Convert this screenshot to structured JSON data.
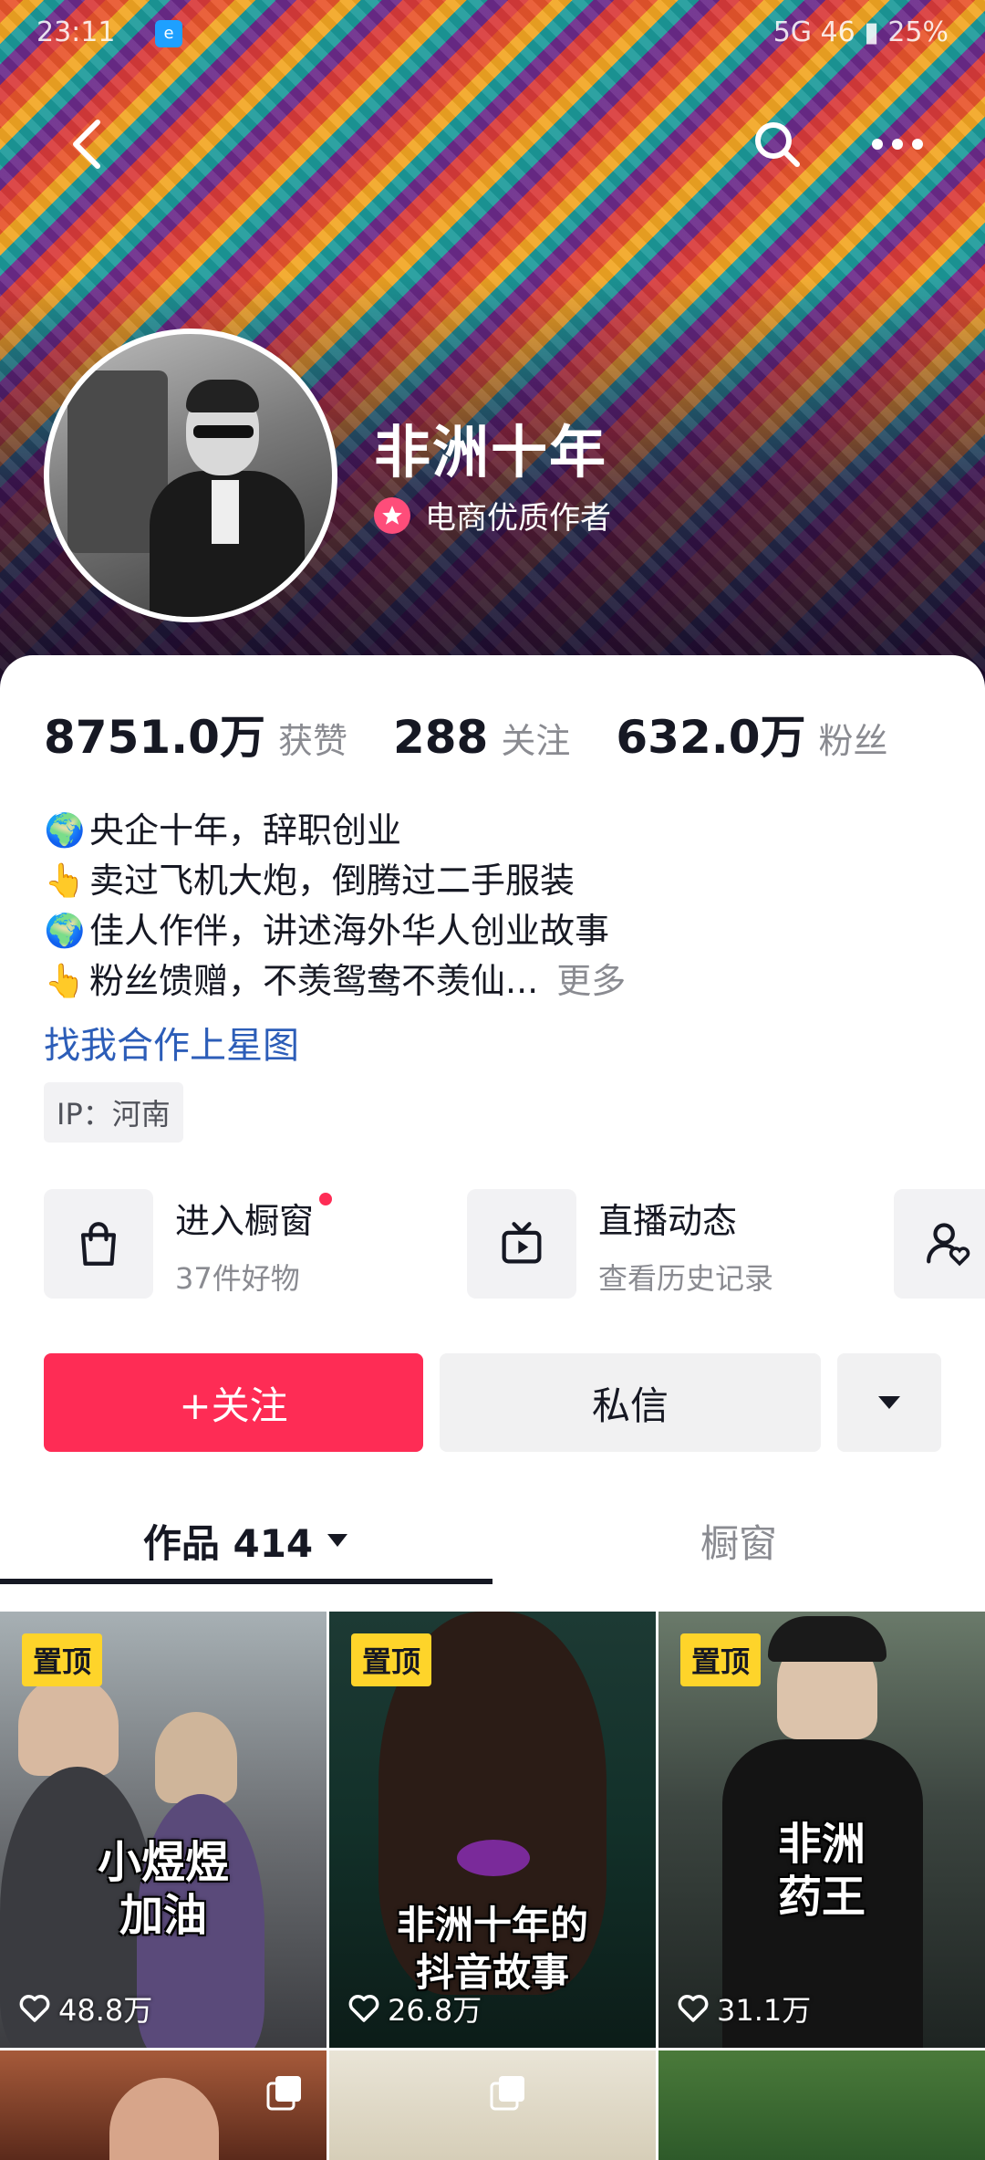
{
  "status_bar": {
    "time": "23:11",
    "app_icon_label": "e",
    "right_text": "5G  46  ▮  25%"
  },
  "header": {
    "icons": {
      "back": "chevron-left-icon",
      "search": "search-icon",
      "more": "more-dots-icon"
    }
  },
  "profile": {
    "name": "非洲十年",
    "badge_label": "电商优质作者",
    "badge_color": "#fe4d7a"
  },
  "stats": [
    {
      "value": "8751.0万",
      "label": "获赞"
    },
    {
      "value": "288",
      "label": "关注"
    },
    {
      "value": "632.0万",
      "label": "粉丝"
    }
  ],
  "bio": {
    "lines": [
      {
        "emoji": "🌍",
        "text": "央企十年，辞职创业"
      },
      {
        "emoji": "👆",
        "text": "卖过飞机大炮，倒腾过二手服装"
      },
      {
        "emoji": "🌍",
        "text": "佳人作伴，讲述海外华人创业故事"
      },
      {
        "emoji": "👆",
        "text": "粉丝馈赠，不羡鸳鸯不羡仙..."
      }
    ],
    "more_label": "更多",
    "star_link": "找我合作上星图",
    "ip_label": "IP：河南"
  },
  "features": [
    {
      "title": "进入橱窗",
      "subtitle": "37件好物",
      "icon": "shopping-bag-icon",
      "has_dot": true
    },
    {
      "title": "直播动态",
      "subtitle": "查看历史记录",
      "icon": "live-tv-icon",
      "has_dot": false
    },
    {
      "title": "",
      "subtitle": "",
      "icon": "user-heart-icon",
      "has_dot": false
    }
  ],
  "actions": {
    "follow_label": "+关注",
    "message_label": "私信",
    "dropdown_icon": "triangle-down-icon",
    "accent_color": "#fe2c55"
  },
  "tabs": [
    {
      "label": "作品 414",
      "active": true
    },
    {
      "label": "橱窗",
      "active": false
    }
  ],
  "videos": [
    {
      "pinned_label": "置顶",
      "caption": [
        "小煜煜",
        "加油"
      ],
      "likes": "48.8万"
    },
    {
      "pinned_label": "置顶",
      "caption": [
        "非洲十年的",
        "抖音故事"
      ],
      "likes": "26.8万"
    },
    {
      "pinned_label": "置顶",
      "caption": [
        "非洲",
        "药王"
      ],
      "likes": "31.1万"
    }
  ]
}
